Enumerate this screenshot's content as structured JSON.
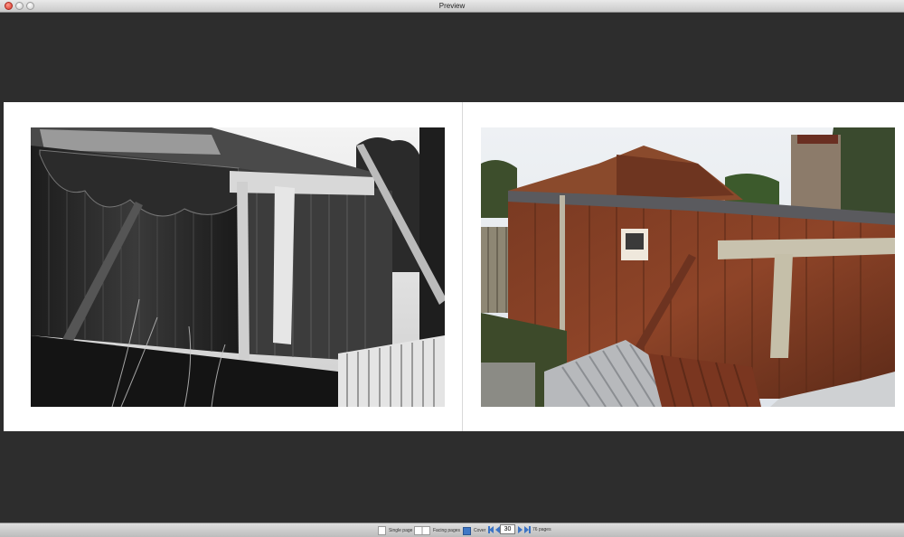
{
  "window": {
    "title": "Preview"
  },
  "spread": {
    "left_photo": {
      "description_icon": "photo-bw-shed"
    },
    "right_photo": {
      "description_icon": "photo-color-shed"
    }
  },
  "bottom_bar": {
    "single_page_label": "Single page",
    "facing_pages_label": "Facing pages",
    "cover_label": "Cover",
    "current_page": "30",
    "total_pages_label": "76 pages"
  },
  "colors": {
    "background": "#2d2d2d",
    "page": "#ffffff",
    "accent": "#3b73c4",
    "close": "#d8362a"
  }
}
